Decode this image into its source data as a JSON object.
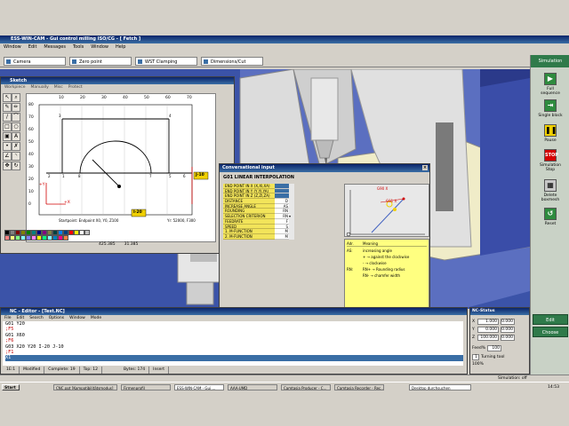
{
  "app": {
    "title": "ESS-WIN-CAM - Gui control milling ISO/CG - [ Fetch ]",
    "menu": [
      "Window",
      "Edit",
      "Messages",
      "Tools",
      "Window",
      "Help"
    ]
  },
  "tabs": [
    {
      "label": "Camera"
    },
    {
      "label": "Zero point"
    },
    {
      "label": "WST Clamping"
    },
    {
      "label": "Dimensions/Cut"
    }
  ],
  "sidebar": {
    "header": "Simulation",
    "buttons": [
      {
        "label": "Full sequence",
        "icon": "arrow-right-icon"
      },
      {
        "label": "Single block",
        "icon": "step-icon"
      },
      {
        "label": "Pause",
        "icon": "pause-icon"
      },
      {
        "label": "Simulation Stop",
        "icon": "stop-icon",
        "glyph": "STOP"
      },
      {
        "label": "Delete boxmesh",
        "icon": "delete-icon"
      },
      {
        "label": "Reset",
        "icon": "reset-icon"
      }
    ],
    "edit_label": "Edit",
    "choose_label": "Choose"
  },
  "sketch": {
    "title": "Sketch",
    "menu": [
      "Workpiece",
      "Manually",
      "Misc",
      "Protect"
    ],
    "x_ticks": [
      "10",
      "20",
      "30",
      "40",
      "50",
      "60",
      "70"
    ],
    "y_ticks": [
      "80",
      "70",
      "60",
      "50",
      "40",
      "30",
      "20",
      "10",
      "0"
    ],
    "points": [
      "1",
      "2",
      "3",
      "4",
      "5",
      "6",
      "7",
      "8"
    ],
    "axis_y": "+Y",
    "axis_x": "+X",
    "startpoint": "Startpoint: Endpoint X0, Y0, Z100",
    "j_label": "J-10",
    "i_label": "I-20",
    "status": [
      "425.385",
      "31.385"
    ],
    "feed": "Yr: 52000, F300"
  },
  "dialog": {
    "title": "Conversational input",
    "header": "G01 LINEAR INTERPOLATION",
    "rows": [
      {
        "label": "END POINT IN X (X,XI,XA)",
        "value": "",
        "active": true
      },
      {
        "label": "END POINT IN Y (Y,YI,YA)",
        "value": "",
        "active": true
      },
      {
        "label": "END POINT IN Z (Z,ZI,ZA)",
        "value": "",
        "active": true
      },
      {
        "label": "DISTANCE",
        "value": "D"
      },
      {
        "label": "INCREASE ANGLE",
        "value": "AS"
      },
      {
        "label": "ROUNDING",
        "value": "RN"
      },
      {
        "label": "SELECTION CRITERION",
        "value": "RN"
      },
      {
        "label": "FEEDRATE",
        "value": "F"
      },
      {
        "label": "SPEED",
        "value": "S"
      },
      {
        "label": "1. M-FUNCTION",
        "value": "M"
      },
      {
        "label": "2. M-FUNCTION",
        "value": "M"
      }
    ],
    "preview_labels": {
      "angle": "G90 X",
      "point": "G91 X"
    },
    "help": {
      "col1": "Adr.",
      "col2": "Meaning",
      "lines": [
        {
          "adr": "AS:",
          "text": "increasing angle"
        },
        {
          "adr": "",
          "text": "+ → against the clockwise"
        },
        {
          "adr": "",
          "text": "- → clockwise"
        },
        {
          "adr": "RN:",
          "text": "RN+ → Rounding radius"
        },
        {
          "adr": "",
          "text": "RN- → chamfer width"
        }
      ]
    },
    "buttons": {
      "standard": "Standard",
      "dialogue": "Dialogue",
      "ok": "OK",
      "cancel": "Cancel"
    }
  },
  "editor": {
    "title": "NC - Editor - [Test.NC]",
    "menu": [
      "File",
      "Edit",
      "Search",
      "Options",
      "Window",
      "Mode"
    ],
    "lines": [
      {
        "text": "G01 Y20",
        "kind": "code"
      },
      {
        "text": ";F5",
        "kind": "comment"
      },
      {
        "text": "G01 X60",
        "kind": "code"
      },
      {
        "text": ";F6",
        "kind": "comment"
      },
      {
        "text": "G03 X20 Y20 I-20 J-10",
        "kind": "code"
      },
      {
        "text": ";F1",
        "kind": "comment"
      },
      {
        "text": "X1",
        "kind": "selected"
      }
    ],
    "status": [
      "1E:1",
      "Modified",
      "Complete: 19",
      "Top: 12",
      "Bytes: 174",
      "Insert"
    ]
  },
  "control": {
    "title": "NC-Status",
    "axes": [
      {
        "axis": "X",
        "value": "1.000",
        "value2": "0.000"
      },
      {
        "axis": "Y",
        "value": "0.000",
        "value2": "0.000"
      },
      {
        "axis": "Z",
        "value": "100.000",
        "value2": "0.000"
      }
    ],
    "feed_label": "Feed%",
    "feed_value": "100",
    "tool_label": "Turning tool",
    "tool_value": "1",
    "rate": "100%"
  },
  "status_bar": {
    "left": "",
    "right": "Simulation: off"
  },
  "taskbar": {
    "start": "Start",
    "tasks": [
      "CNC.ppt [Kompatibilitätsmodus]",
      "Firmenprofil",
      "ESS-WIN-CAM - Gui ...",
      "AAA-UMD",
      "Camtasia Producer - C...",
      "Camtasia Recorder - Rec..."
    ],
    "desktop": "Desktop durchsuchen",
    "clock": "14:53"
  }
}
